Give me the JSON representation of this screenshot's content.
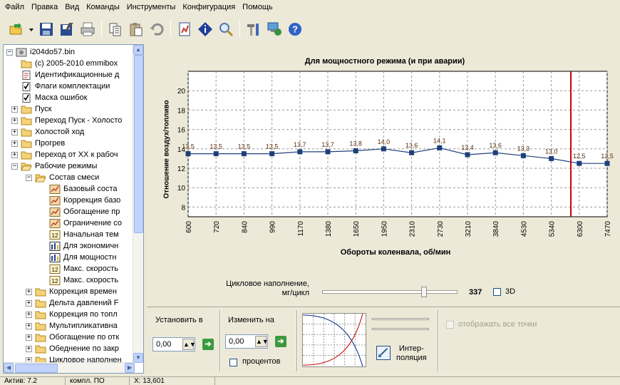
{
  "menu": [
    "Файл",
    "Правка",
    "Вид",
    "Команды",
    "Инструменты",
    "Конфигурация",
    "Помощь"
  ],
  "toolbar": {
    "icons": [
      "open-icon",
      "dropdown-arrow-icon",
      "save-icon",
      "save-as-icon",
      "print-icon",
      "copy-icon",
      "paste-icon",
      "undo-icon",
      "report-icon",
      "info-icon",
      "search-icon",
      "tools-icon",
      "network-icon",
      "help-icon"
    ]
  },
  "tree": {
    "root": "i204do57.bin",
    "items": [
      {
        "label": "(c) 2005-2010 emmibox",
        "icon": "folder-icon"
      },
      {
        "label": "Идентификационные д",
        "icon": "document-icon"
      },
      {
        "label": "Флаги комплектации",
        "icon": "checklist-icon"
      },
      {
        "label": "Маска ошибок",
        "icon": "checklist-icon"
      },
      {
        "label": "Пуск",
        "icon": "folder-icon"
      },
      {
        "label": "Переход Пуск - Холосто",
        "icon": "folder-icon"
      },
      {
        "label": "Холостой ход",
        "icon": "folder-icon"
      },
      {
        "label": "Прогрев",
        "icon": "folder-icon"
      },
      {
        "label": "Переход от ХХ к рабоч",
        "icon": "folder-icon"
      },
      {
        "label": "Рабочие режимы",
        "icon": "folder-open-icon"
      },
      {
        "label": "Состав смеси",
        "icon": "folder-open-icon"
      },
      {
        "label": "Базовый соста",
        "icon": "table-icon"
      },
      {
        "label": "Коррекция базо",
        "icon": "table-icon"
      },
      {
        "label": "Обогащение пр",
        "icon": "table-icon"
      },
      {
        "label": "Ограничение со",
        "icon": "table-icon"
      },
      {
        "label": "Начальная тем",
        "icon": "value-icon"
      },
      {
        "label": "Для экономичн",
        "icon": "chart-icon"
      },
      {
        "label": "Для мощностн",
        "icon": "chart-icon"
      },
      {
        "label": "Макс. скорость",
        "icon": "value-icon"
      },
      {
        "label": "Макс. скорость",
        "icon": "value-icon"
      },
      {
        "label": "Коррекция времен",
        "icon": "folder-icon"
      },
      {
        "label": "Дельта давлений F",
        "icon": "folder-icon"
      },
      {
        "label": "Коррекция по топл",
        "icon": "folder-icon"
      },
      {
        "label": "Мультипликативна",
        "icon": "folder-icon"
      },
      {
        "label": "Обогащение по отк",
        "icon": "folder-icon"
      },
      {
        "label": "Обеднение по закр",
        "icon": "folder-icon"
      },
      {
        "label": "Цикловое наполнен",
        "icon": "folder-icon"
      }
    ]
  },
  "chart_data": {
    "type": "line",
    "title": "Для мощностного режима (и при аварии)",
    "xlabel": "Обороты коленвала, об/мин",
    "ylabel": "Отношение воздух/топливо",
    "categories": [
      "600",
      "720",
      "840",
      "990",
      "1170",
      "1380",
      "1650",
      "1950",
      "2310",
      "2730",
      "3210",
      "3840",
      "4530",
      "5340",
      "6300",
      "7470"
    ],
    "values": [
      13.5,
      13.5,
      13.5,
      13.5,
      13.7,
      13.7,
      13.8,
      14.0,
      13.6,
      14.1,
      13.4,
      13.6,
      13.3,
      13.0,
      12.5,
      12.5
    ],
    "value_labels": [
      "13,5",
      "13,5",
      "13,5",
      "13,5",
      "13,7",
      "13,7",
      "13,8",
      "14,0",
      "13,6",
      "14,1",
      "13,4",
      "13,6",
      "13,3",
      "13,0",
      "12,5",
      "12,5"
    ],
    "yticks": [
      "8",
      "10",
      "12",
      "14",
      "16",
      "18",
      "20"
    ],
    "ylim": [
      7,
      22
    ],
    "grid": true,
    "marker_category_index": 13.7,
    "line_color": "#1F3F7A",
    "marker_line_color": "#CC0000"
  },
  "fill": {
    "label_line1": "Цикловое наполнение,",
    "label_line2": "мг/цикл",
    "value": "337",
    "slider_fraction": 0.74,
    "checkbox_3d": "3D"
  },
  "controls": {
    "set_label": "Установить в",
    "set_value": "0,00",
    "change_label": "Изменить на",
    "change_value": "0,00",
    "percent_label": "процентов",
    "interp_label_1": "Интер-",
    "interp_label_2": "поляция",
    "show_all_label": "отображать все точки"
  },
  "statusbar": [
    "Актив: 7.2",
    "компл. ПО",
    "X: 13,601"
  ]
}
